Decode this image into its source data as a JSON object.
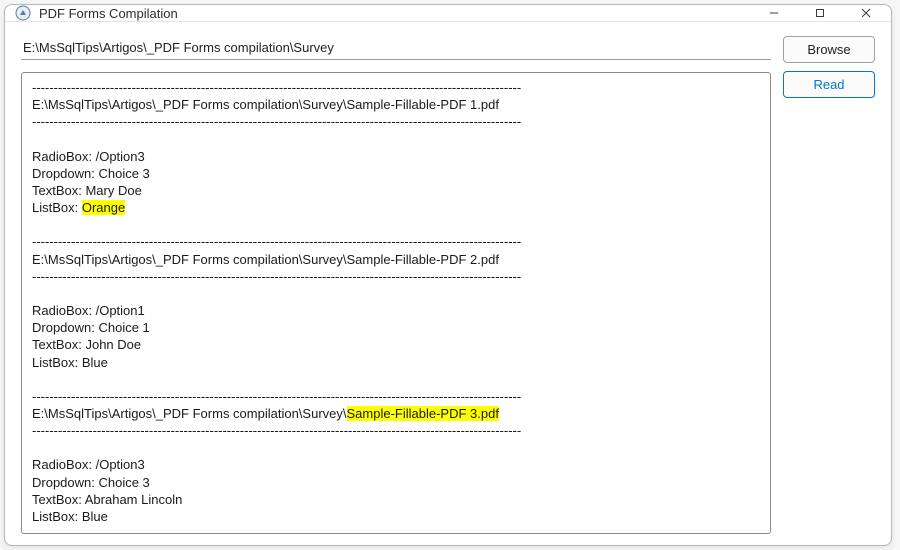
{
  "window": {
    "title": "PDF Forms Compilation"
  },
  "path_input": {
    "value": "E:\\MsSqlTips\\Artigos\\_PDF Forms compilation\\Survey"
  },
  "buttons": {
    "browse": "Browse",
    "read": "Read"
  },
  "output": {
    "sep": "-----------------------------------------------------------------------------------------------------------------",
    "files": [
      {
        "path_prefix": "E:\\MsSqlTips\\Artigos\\_PDF Forms compilation\\Survey\\",
        "filename": "Sample-Fillable-PDF 1.pdf",
        "filename_highlighted": false,
        "fields": {
          "radio": "/Option3",
          "dropdown": "Choice 3",
          "textbox": "Mary Doe",
          "listbox": "Orange",
          "listbox_highlighted": true
        }
      },
      {
        "path_prefix": "E:\\MsSqlTips\\Artigos\\_PDF Forms compilation\\Survey\\",
        "filename": "Sample-Fillable-PDF 2.pdf",
        "filename_highlighted": false,
        "fields": {
          "radio": "/Option1",
          "dropdown": "Choice 1",
          "textbox": "John Doe",
          "listbox": "Blue",
          "listbox_highlighted": false
        }
      },
      {
        "path_prefix": "E:\\MsSqlTips\\Artigos\\_PDF Forms compilation\\Survey\\",
        "filename": "Sample-Fillable-PDF 3.pdf",
        "filename_highlighted": true,
        "fields": {
          "radio": "/Option3",
          "dropdown": "Choice 3",
          "textbox": "Abraham Lincoln",
          "listbox": "Blue",
          "listbox_highlighted": false
        }
      }
    ],
    "labels": {
      "radio": "RadioBox: ",
      "dropdown": "Dropdown: ",
      "textbox": "TextBox: ",
      "listbox": "ListBox: "
    }
  }
}
